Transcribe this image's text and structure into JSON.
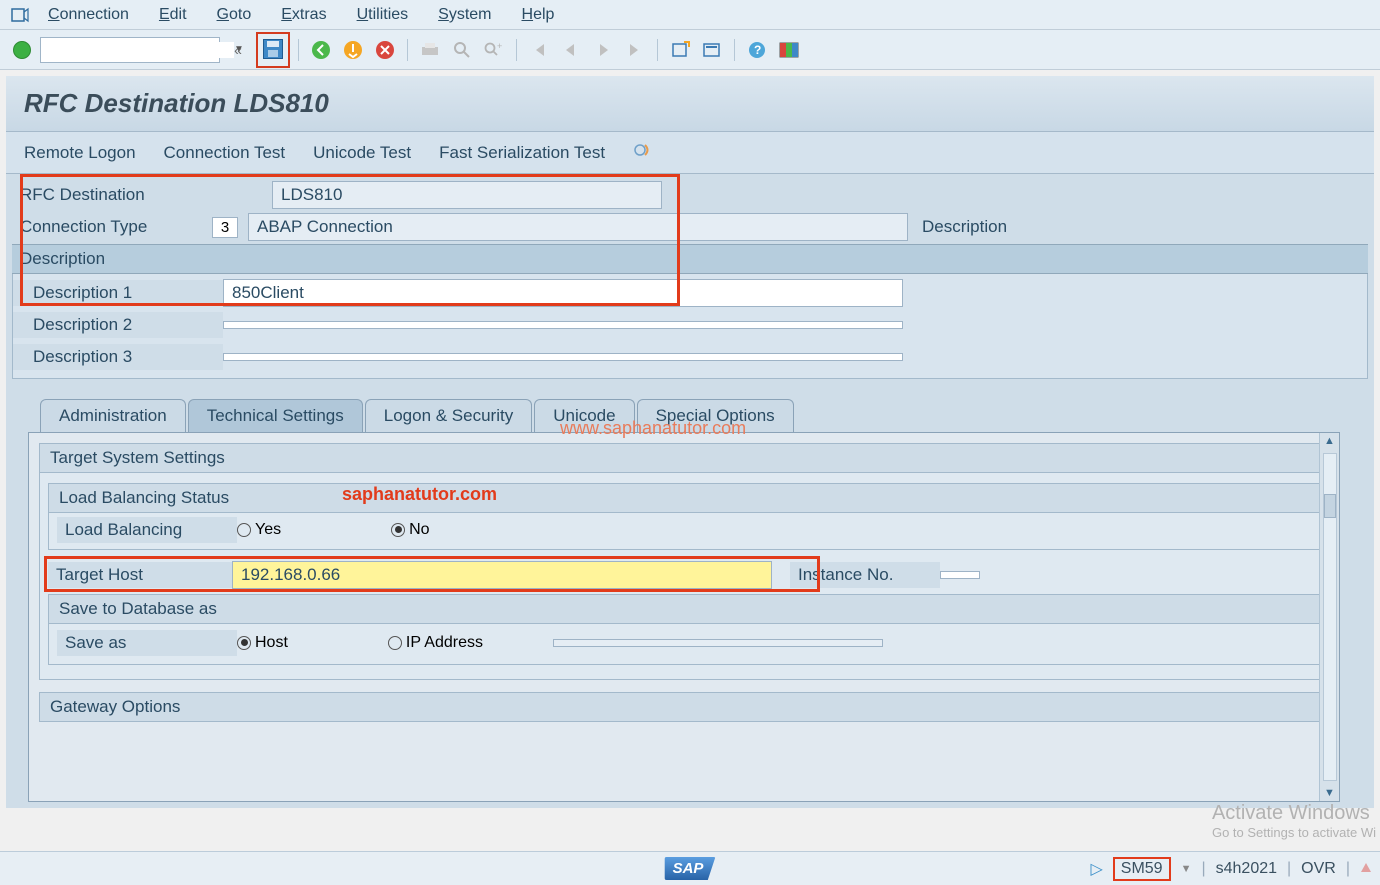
{
  "menu": {
    "items": [
      "Connection",
      "Edit",
      "Goto",
      "Extras",
      "Utilities",
      "System",
      "Help"
    ]
  },
  "title": "RFC Destination LDS810",
  "actions": [
    "Remote Logon",
    "Connection Test",
    "Unicode Test",
    "Fast Serialization Test"
  ],
  "form": {
    "rfc_dest_label": "RFC Destination",
    "rfc_dest_value": "LDS810",
    "conn_type_label": "Connection Type",
    "conn_type_code": "3",
    "conn_type_value": "ABAP Connection",
    "conn_type_rightlabel": "Description",
    "desc_header": "Description",
    "desc1_label": "Description 1",
    "desc1_value": "850Client",
    "desc2_label": "Description 2",
    "desc2_value": "",
    "desc3_label": "Description 3",
    "desc3_value": ""
  },
  "tabs": [
    "Administration",
    "Technical Settings",
    "Logon & Security",
    "Unicode",
    "Special Options"
  ],
  "tech": {
    "target_sys_head": "Target System Settings",
    "lb_head": "Load Balancing Status",
    "lb_label": "Load Balancing",
    "lb_yes": "Yes",
    "lb_no": "No",
    "target_host_label": "Target Host",
    "target_host_value": "192.168.0.66",
    "instance_no_label": "Instance No.",
    "instance_no_value": "",
    "save_db_head": "Save to Database as",
    "save_as_label": "Save as",
    "save_host": "Host",
    "save_ip": "IP Address",
    "gateway_head": "Gateway Options"
  },
  "watermarks": {
    "url": "www.saphanatutor.com",
    "brand": "saphanatutor.com"
  },
  "status": {
    "tcode": "SM59",
    "system": "s4h2021",
    "mode": "OVR"
  },
  "activate": {
    "line1": "Activate Windows",
    "line2": "Go to Settings to activate Wi"
  }
}
